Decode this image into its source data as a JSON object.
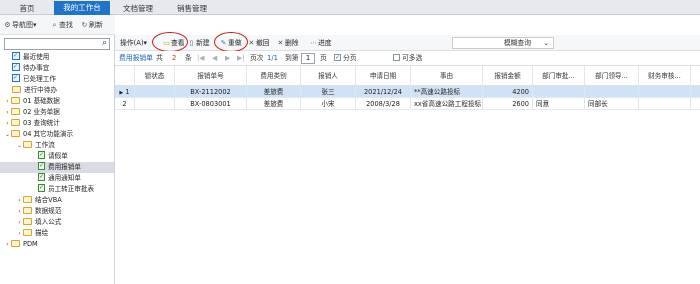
{
  "top_tabs": [
    "首页",
    "我的工作台",
    "文档管理",
    "销售管理"
  ],
  "left_toolbar": {
    "nav": "导航图",
    "find": "查找",
    "refresh": "刷新"
  },
  "left_search": {
    "value": ""
  },
  "tree": [
    "最近使用",
    "待办事宜",
    "已处理工作",
    "进行中待办",
    "01 基础数据",
    "02 业务单据",
    "03 查询统计",
    "04 其它功能演示",
    "工作流",
    "请假单",
    "费用报销单",
    "通用通知单",
    "员工转正审批表",
    "结合VBA",
    "数据规范",
    "填入公式",
    "描绘",
    "PDM"
  ],
  "right_toolbar": {
    "operate": "操作(A)",
    "view": "查看",
    "new": "新建",
    "redo": "重做",
    "withdraw": "撤回",
    "delete": "删除",
    "progress": "进度",
    "fuzzy": "模糊查询"
  },
  "pager": {
    "source": "费用报销单",
    "total_prefix": "共",
    "total": "2",
    "total_suffix": "条",
    "page_prefix": "页次",
    "page_of": "1/1",
    "goto": "到第",
    "page_input": "1",
    "page_suffix": "页",
    "paginate": "分页",
    "multi": "可多选"
  },
  "columns": [
    "锁状态",
    "报销单号",
    "费用类别",
    "报销人",
    "申请日期",
    "事由",
    "报销金额",
    "部门审批...",
    "部门领导...",
    "财务审核..."
  ],
  "rows": [
    {
      "idx": "1",
      "no": "BX-2112002",
      "cat": "差旅费",
      "person": "张三",
      "date": "2021/12/24",
      "reason": "**高速公路投标",
      "amount": "4200",
      "dept": "",
      "lead": "",
      "fin": ""
    },
    {
      "idx": "2",
      "no": "BX-0803001",
      "cat": "差旅费",
      "person": "小宋",
      "date": "2008/3/28",
      "reason": "xx省高速公路工程投标",
      "amount": "2600",
      "dept": "同意",
      "lead": "同部长",
      "fin": ""
    }
  ],
  "colors": {
    "accent": "#1f74c8",
    "selection": "#cfe2f7",
    "highlight_circle": "#d01818"
  }
}
